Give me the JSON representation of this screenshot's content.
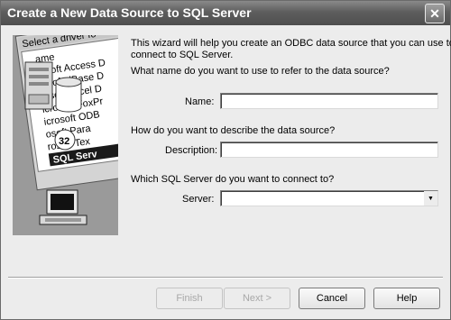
{
  "window": {
    "title": "Create a New Data Source to SQL Server",
    "close_glyph": "✕"
  },
  "intro": {
    "line1": "This wizard will help you create an ODBC data source that you can use to",
    "line2": "connect to SQL Server."
  },
  "name_section": {
    "question": "What name do you want to use to refer to the data source?",
    "label": "Name:",
    "value": ""
  },
  "description_section": {
    "question": "How do you want to describe the data source?",
    "label": "Description:",
    "value": ""
  },
  "server_section": {
    "question": "Which SQL Server do you want to connect to?",
    "label": "Server:",
    "value": ""
  },
  "buttons": {
    "finish": "Finish",
    "next": "Next >",
    "cancel": "Cancel",
    "help": "Help"
  },
  "illustration": {
    "header": "Select a driver fo",
    "drivers": [
      "ame",
      "rosoft Access D",
      "rosoft dBase D",
      "rosoft Excel D",
      "icrosoft FoxPr",
      "icrosoft ODB",
      "osoft Para",
      "rosoft Tex"
    ],
    "selected": "SQL Serv"
  }
}
